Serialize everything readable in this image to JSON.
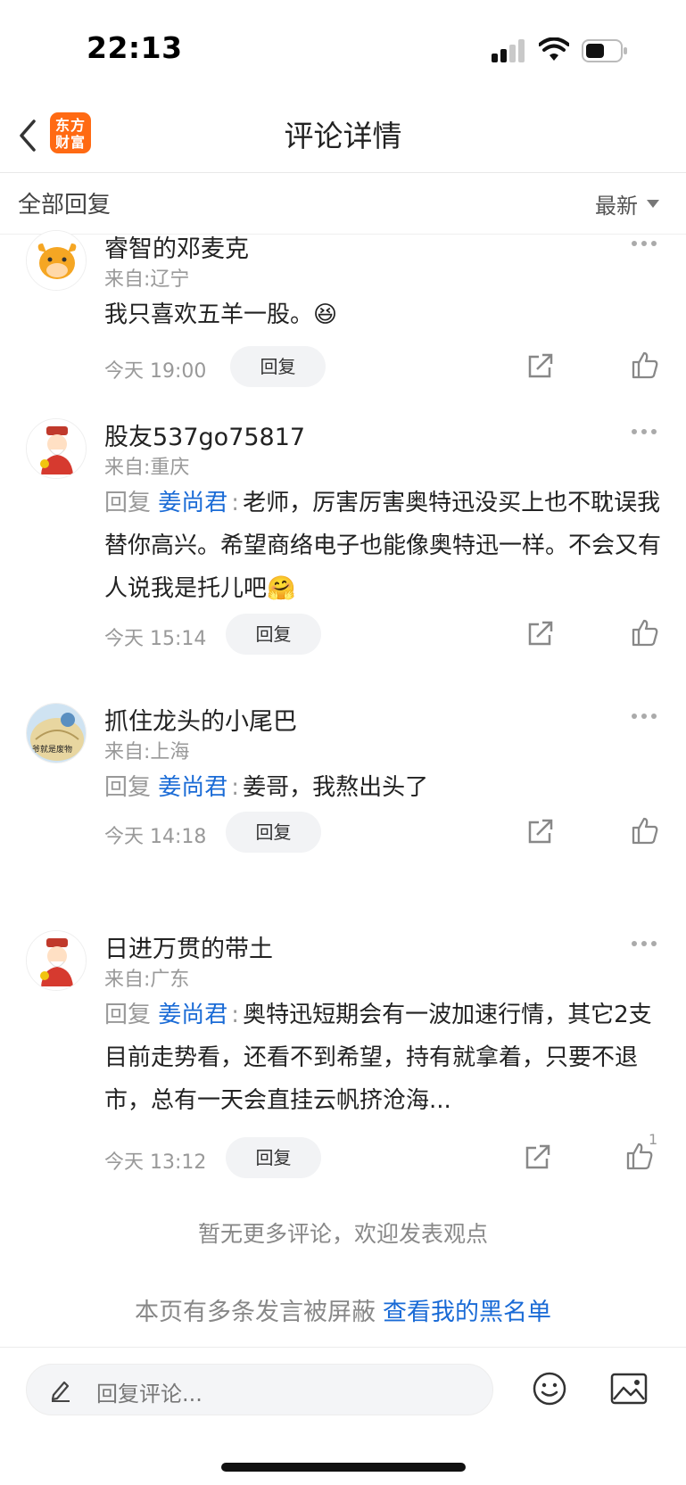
{
  "status_bar": {
    "time": "22:13"
  },
  "nav": {
    "title": "评论详情",
    "logo_text_line1": "东方",
    "logo_text_line2": "财富"
  },
  "filter": {
    "label": "全部回复",
    "sort_label": "最新"
  },
  "comments": [
    {
      "username": "睿智的邓麦克",
      "location": "来自:辽宁",
      "text": "我只喜欢五羊一股。😆",
      "is_reply": false,
      "time": "今天 19:00",
      "reply_label": "回复",
      "avatar": "bull-avatar-icon"
    },
    {
      "username": "股友537go75817",
      "location": "来自:重庆",
      "reply_prefix": "回复",
      "mention": "姜尚君",
      "colon": ":",
      "text": "老师，厉害厉害奥特迅没买上也不耽误我替你高兴。希望商络电子也能像奥特迅一样。不会又有人说我是托儿吧🤗",
      "is_reply": true,
      "time": "今天 15:14",
      "reply_label": "回复",
      "avatar": "fortune-god-avatar-icon"
    },
    {
      "username": "抓住龙头的小尾巴",
      "location": "来自:上海",
      "reply_prefix": "回复",
      "mention": "姜尚君",
      "colon": ":",
      "text": "姜哥，我熬出头了",
      "is_reply": true,
      "time": "今天 14:18",
      "reply_label": "回复",
      "avatar": "cartoon-avatar-icon",
      "avatar_caption": "爷就是废物"
    },
    {
      "username": "日进万贯的带土",
      "location": "来自:广东",
      "reply_prefix": "回复",
      "mention": "姜尚君",
      "colon": ":",
      "text": "奥特迅短期会有一波加速行情，其它2支目前走势看，还看不到希望，持有就拿着，只要不退市，总有一天会直挂云帆挤沧海...",
      "is_reply": true,
      "time": "今天 13:12",
      "reply_label": "回复",
      "like_count": "1",
      "avatar": "fortune-god-avatar-icon"
    }
  ],
  "footer": {
    "no_more": "暂无更多评论，欢迎发表观点",
    "blocked_text": "本页有多条发言被屏蔽",
    "blocked_link": "查看我的黑名单"
  },
  "bottom_bar": {
    "placeholder": "回复评论..."
  },
  "colors": {
    "accent_blue": "#1a6bd6",
    "logo_orange": "#ff6a13"
  }
}
